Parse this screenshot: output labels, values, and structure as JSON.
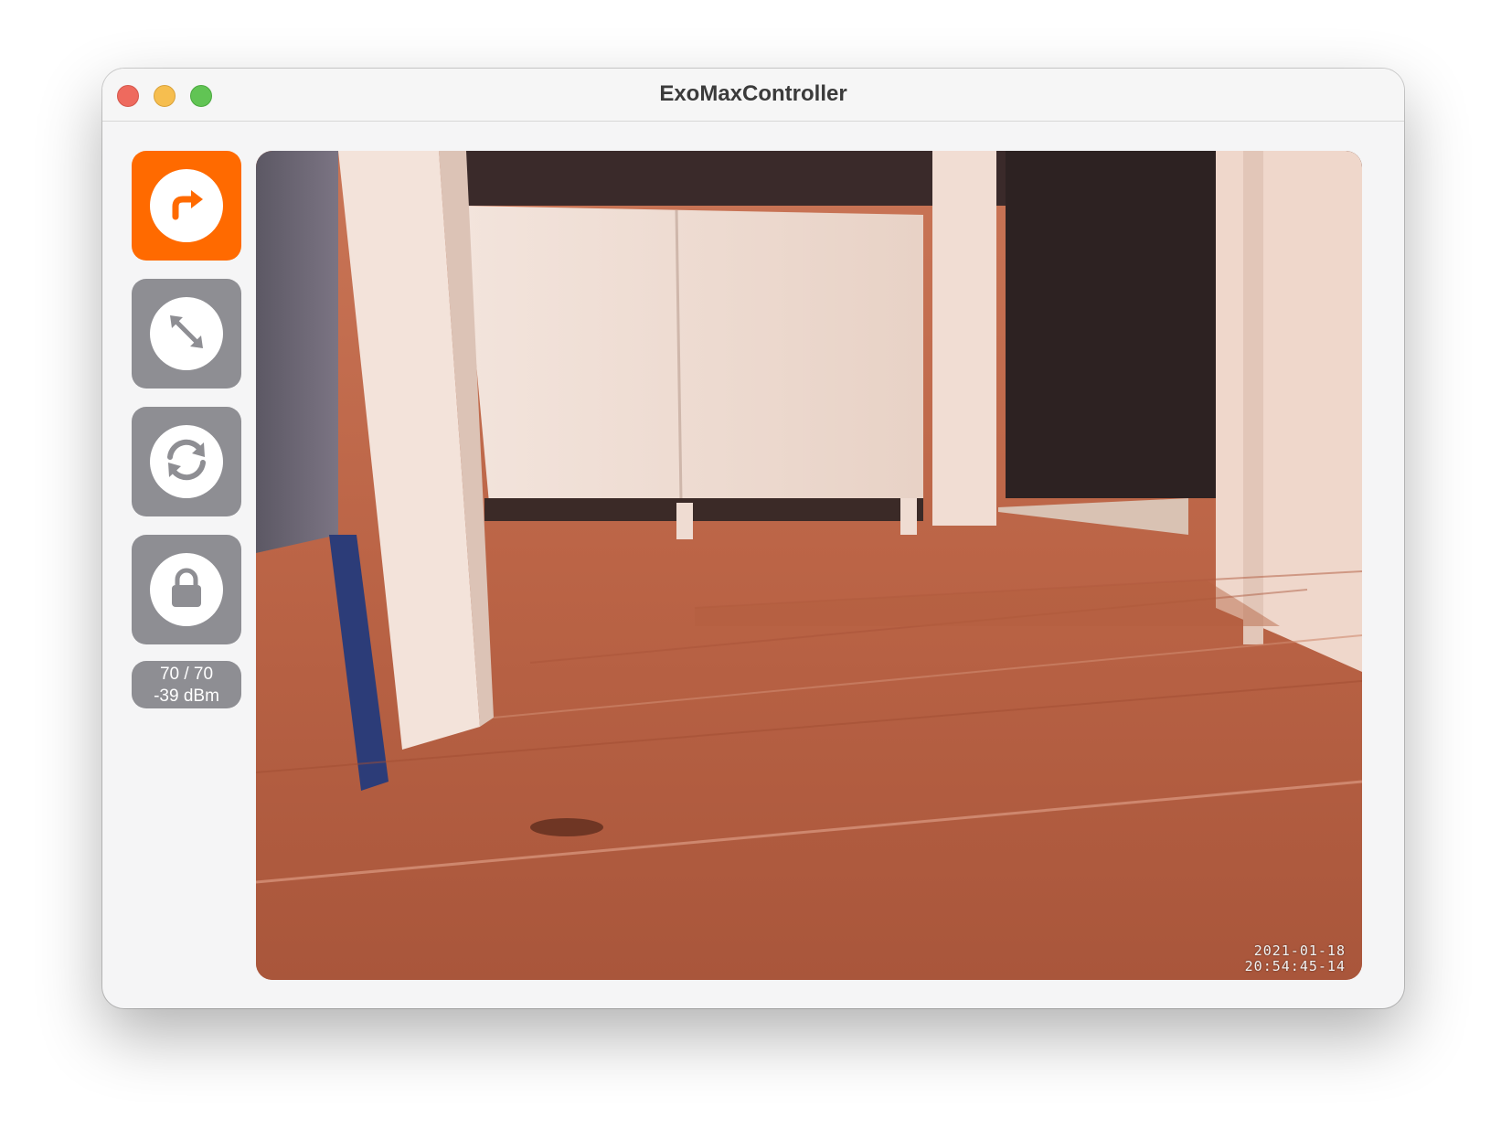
{
  "window": {
    "title": "ExoMaxController"
  },
  "sidebar": {
    "buttons": [
      {
        "name": "forward-turn",
        "icon": "arrow-turn-right-icon",
        "active": true
      },
      {
        "name": "expand",
        "icon": "expand-arrows-icon",
        "active": false
      },
      {
        "name": "refresh",
        "icon": "sync-arrows-icon",
        "active": false
      },
      {
        "name": "lock",
        "icon": "lock-icon",
        "active": false
      }
    ],
    "status": {
      "speed": "70 / 70",
      "signal": "-39 dBm"
    }
  },
  "video": {
    "date": "2021-01-18",
    "time": "20:54:45-14"
  },
  "colors": {
    "accent": "#ff6a00",
    "button_gray": "#8e8e93"
  }
}
